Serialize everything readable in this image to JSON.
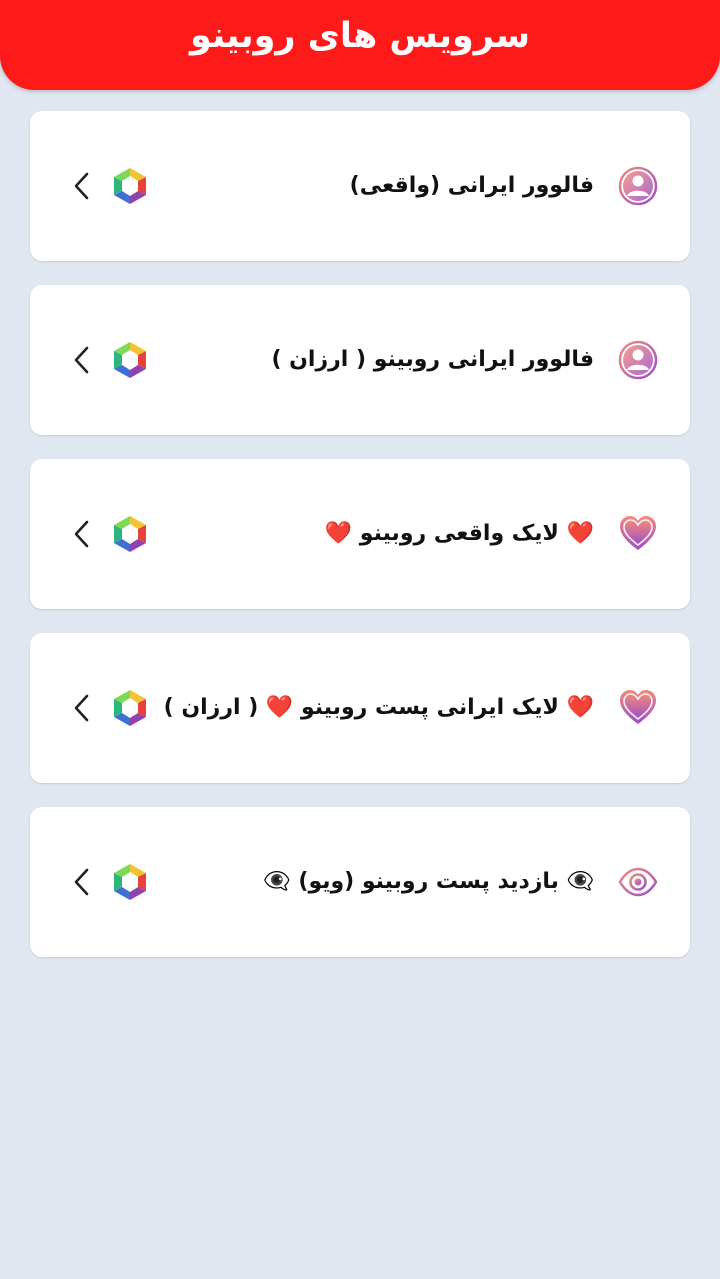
{
  "header": {
    "title": "سرویس های روبینو"
  },
  "services": [
    {
      "label": "فالوور ایرانی (واقعی)",
      "icon": "user-circle-icon"
    },
    {
      "label": "فالوور ایرانی روبینو ( ارزان )",
      "icon": "user-circle-icon"
    },
    {
      "label": "❤️ لایک واقعی روبینو ❤️",
      "icon": "heart-icon"
    },
    {
      "label": "❤️ لایک ایرانی پست روبینو ❤️ ( ارزان )",
      "icon": "heart-icon"
    },
    {
      "label": "👁‍🗨 بازدید پست روبینو (ویو) 👁‍🗨",
      "icon": "eye-icon"
    }
  ],
  "colors": {
    "header": "#ff1a1a",
    "background": "#e1e7f1",
    "card": "#ffffff",
    "icon_gradient_start": "#f58a7a",
    "icon_gradient_end": "#9b4fc9"
  },
  "icons": {
    "brand": "rubika-hexagon-icon",
    "chevron": "chevron-left-icon"
  }
}
